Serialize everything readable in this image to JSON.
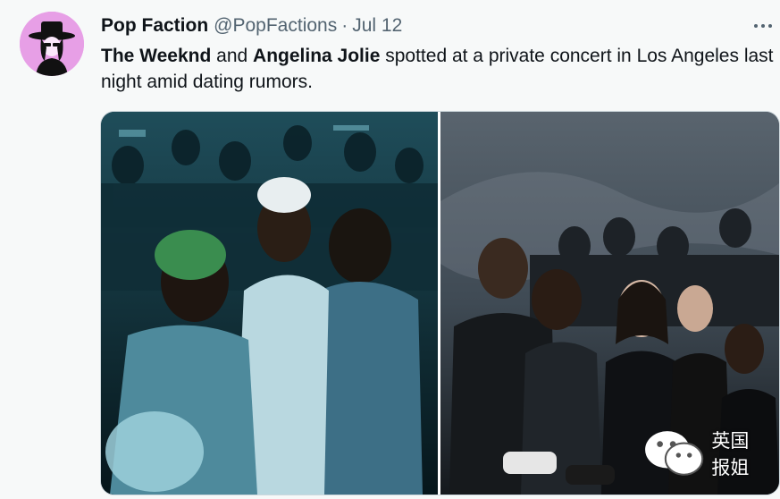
{
  "tweet": {
    "display_name": "Pop Faction",
    "handle": "@PopFactions",
    "separator": "·",
    "date": "Jul 12",
    "text_parts": {
      "mention_1": "The Weeknd",
      "connector": " and ",
      "mention_2": "Angelina Jolie",
      "rest": " spotted at a private concert in Los Angeles last night amid dating rumors."
    }
  },
  "watermark": {
    "text": "英国报姐"
  },
  "icons": {
    "avatar": "avatar-icon",
    "more": "more-options-icon",
    "watermark": "wechat-icon"
  },
  "colors": {
    "avatar_bg": "#e79fe6",
    "secondary_text": "#536471",
    "background": "#f7f9f9"
  }
}
